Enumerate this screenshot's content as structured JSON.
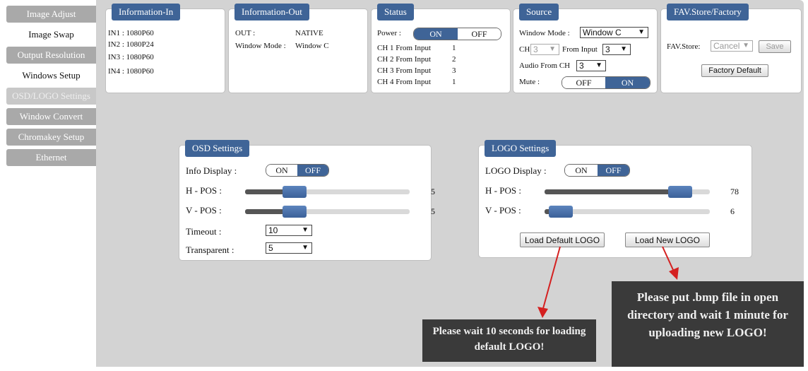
{
  "sidebar": {
    "items": [
      {
        "label": "Image Adjust",
        "style": "grey"
      },
      {
        "label": "Image Swap",
        "style": "white"
      },
      {
        "label": "Output Resolution",
        "style": "grey"
      },
      {
        "label": "Windows Setup",
        "style": "white"
      },
      {
        "label": "OSD/LOGO Settings",
        "style": "active"
      },
      {
        "label": "Window Convert",
        "style": "grey"
      },
      {
        "label": "Chromakey Setup",
        "style": "grey"
      },
      {
        "label": "Ethernet",
        "style": "grey"
      }
    ]
  },
  "info_in": {
    "title": "Information-In",
    "lines": [
      "IN1 : 1080P60",
      "IN2 : 1080P24",
      "IN3 : 1080P60",
      "IN4 : 1080P60"
    ]
  },
  "info_out": {
    "title": "Information-Out",
    "out_label": "OUT :",
    "out_value": "NATIVE",
    "window_mode_label": "Window Mode :",
    "window_mode_value": "Window C"
  },
  "status": {
    "title": "Status",
    "power_label": "Power :",
    "power_on": "ON",
    "power_off": "OFF",
    "power_state": "ON",
    "channels": [
      {
        "label": "CH 1 From Input",
        "value": "1"
      },
      {
        "label": "CH 2 From Input",
        "value": "2"
      },
      {
        "label": "CH 3 From Input",
        "value": "3"
      },
      {
        "label": "CH 4 From Input",
        "value": "1"
      }
    ]
  },
  "source": {
    "title": "Source",
    "window_mode_label": "Window Mode :",
    "window_mode_value": "Window C",
    "ch_label": "CH",
    "ch_value": "3",
    "from_input_label": "From Input",
    "from_input_value": "3",
    "audio_label": "Audio From CH",
    "audio_value": "3",
    "mute_label": "Mute :",
    "mute_off": "OFF",
    "mute_on": "ON",
    "mute_state": "ON"
  },
  "fav": {
    "title": "FAV.Store/Factory",
    "store_label": "FAV.Store:",
    "store_value": "Cancel",
    "save_label": "Save",
    "factory_label": "Factory Default"
  },
  "osd": {
    "title": "OSD Settings",
    "info_display_label": "Info Display :",
    "on_label": "ON",
    "off_label": "OFF",
    "info_display_state": "OFF",
    "hpos_label": "H - POS :",
    "hpos_value": "5",
    "hpos_fraction": 0.3,
    "vpos_label": "V - POS :",
    "vpos_value": "5",
    "vpos_fraction": 0.3,
    "timeout_label": "Timeout :",
    "timeout_value": "10",
    "transparent_label": "Transparent :",
    "transparent_value": "5"
  },
  "logo": {
    "title": "LOGO Settings",
    "display_label": "LOGO Display :",
    "on_label": "ON",
    "off_label": "OFF",
    "display_state": "OFF",
    "hpos_label": "H - POS :",
    "hpos_value": "78",
    "hpos_fraction": 0.82,
    "vpos_label": "V - POS :",
    "vpos_value": "6",
    "vpos_fraction": 0.1,
    "load_default_label": "Load Default LOGO",
    "load_new_label": "Load New LOGO"
  },
  "annotations": {
    "note_default": "Please wait 10 seconds for loading default LOGO!",
    "note_new": "Please put .bmp file in open directory and wait 1 minute for uploading new LOGO!",
    "arrow_color": "#d42020"
  },
  "colors": {
    "accent": "#3f6497",
    "background": "#d3d3d3",
    "sidebar_grey": "#a9a9a9"
  }
}
